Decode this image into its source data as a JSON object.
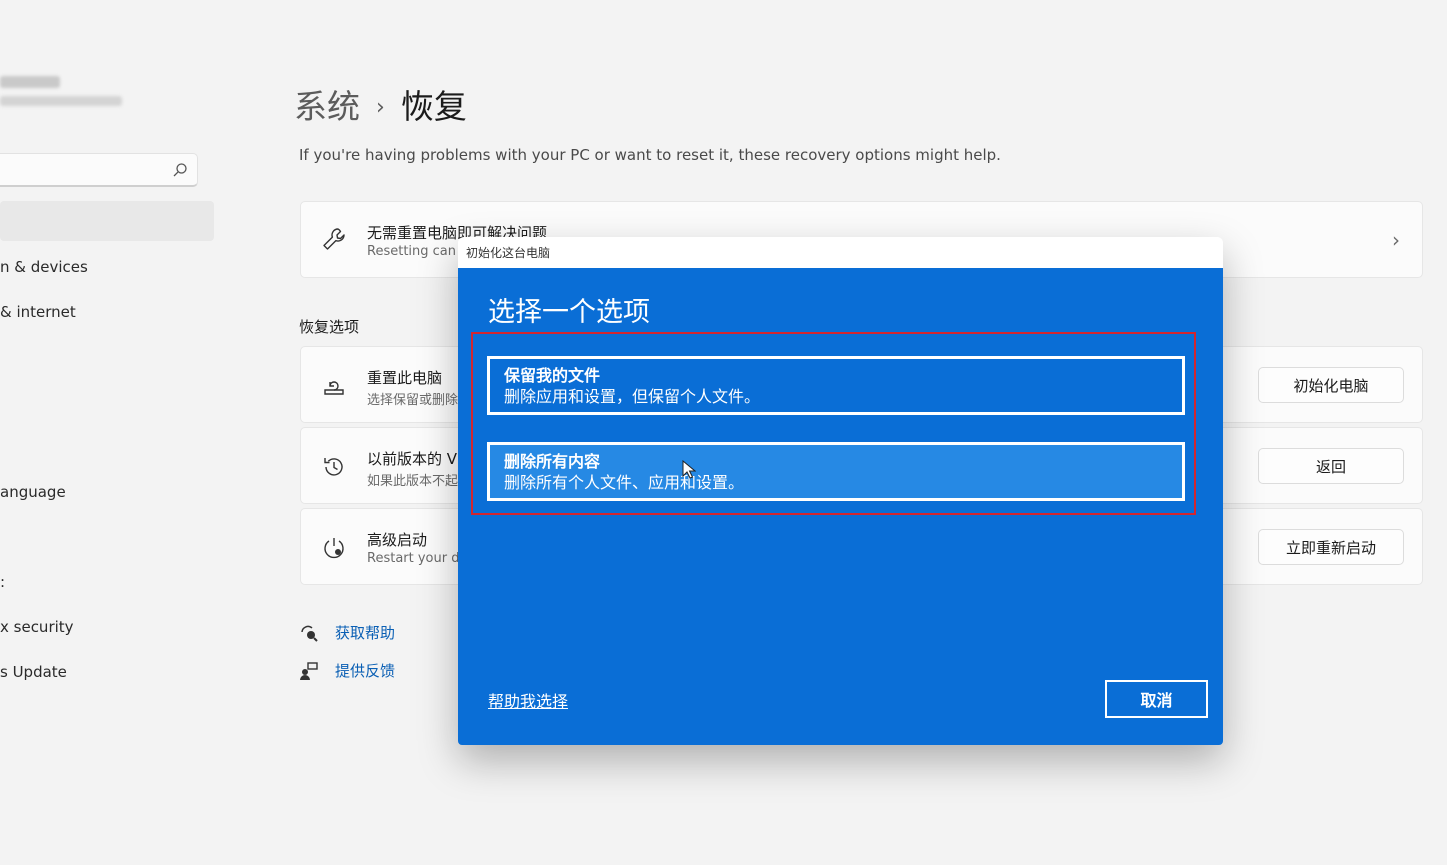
{
  "sidebar": {
    "items": [
      {
        "id": "bluetooth-devices",
        "label": "n & devices"
      },
      {
        "id": "network-internet",
        "label": "& internet"
      },
      {
        "id": "time-language",
        "label": "anguage"
      },
      {
        "id": "gaming",
        "label": ":"
      },
      {
        "id": "privacy-security",
        "label": "x security"
      },
      {
        "id": "windows-update",
        "label": "s Update"
      }
    ]
  },
  "header": {
    "breadcrumb_parent": "系统",
    "breadcrumb_separator": "›",
    "page_title": "恢复",
    "intro": "If you're having problems with your PC or want to reset it, these recovery options might help."
  },
  "fix_card": {
    "title": "无需重置电脑即可解决问题",
    "subtitle": "Resetting can t"
  },
  "section_label": "恢复选项",
  "options": [
    {
      "title": "重置此电脑",
      "subtitle": "选择保留或删除",
      "button": "初始化电脑"
    },
    {
      "title": "以前版本的 V",
      "subtitle": "如果此版本不起",
      "button": "返回"
    },
    {
      "title": "高级启动",
      "subtitle": "Restart your de",
      "button": "立即重新启动"
    }
  ],
  "links": {
    "get_help": "获取帮助",
    "feedback": "提供反馈"
  },
  "dialog": {
    "window_title": "初始化这台电脑",
    "heading": "选择一个选项",
    "keep": {
      "title": "保留我的文件",
      "desc": "删除应用和设置，但保留个人文件。"
    },
    "remove": {
      "title": "删除所有内容",
      "desc": "删除所有个人文件、应用和设置。"
    },
    "help_link": "帮助我选择",
    "cancel": "取消"
  },
  "colors": {
    "dialog_blue": "#0a6ed6",
    "option_hover": "#2689e4",
    "highlight_red": "#d3262f",
    "link_blue": "#0a5fb4"
  }
}
